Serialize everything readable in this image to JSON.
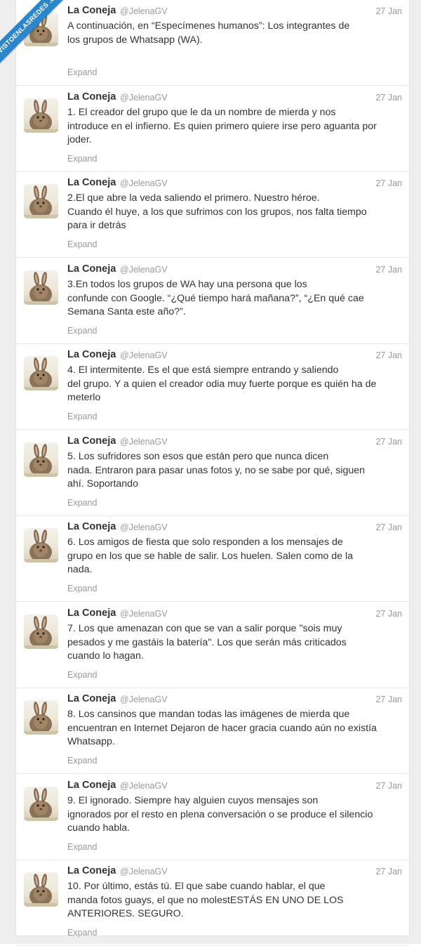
{
  "watermark": {
    "text": "VISTOENLASREDES .com"
  },
  "tweets": [
    {
      "name": "La Coneja",
      "handle": "@JelenaGV",
      "time": "27 Jan",
      "text": "A continuación, en “Especímenes humanos”: Los integrantes de\nlos grupos de Whatsapp (WA).",
      "expand": "Expand"
    },
    {
      "name": "La Coneja",
      "handle": "@JelenaGV",
      "time": "27 Jan",
      "text": "1. El creador del grupo que le da un nombre de mierda y nos\nintroduce en el infierno. Es quien primero quiere irse pero aguanta por\njoder.",
      "expand": "Expand"
    },
    {
      "name": "La Coneja",
      "handle": "@JelenaGV",
      "time": "27 Jan",
      "text": "2.El que abre la veda saliendo el primero. Nuestro héroe.\nCuando él huye, a los que sufrimos con los grupos, nos falta tiempo\npara ir detrás",
      "expand": "Expand"
    },
    {
      "name": "La Coneja",
      "handle": "@JelenaGV",
      "time": "27 Jan",
      "text": "3.En todos los grupos de WA hay una persona que los\nconfunde con Google. “¿Qué tiempo hará mañana?”, “¿En qué cae\nSemana Santa este año?”.",
      "expand": "Expand"
    },
    {
      "name": "La Coneja",
      "handle": "@JelenaGV",
      "time": "27 Jan",
      "text": "4. El intermitente. Es el que está siempre entrando y saliendo\ndel grupo. Y a quien el creador odia muy fuerte porque es quién ha de\nmeterlo",
      "expand": "Expand"
    },
    {
      "name": "La Coneja",
      "handle": "@JelenaGV",
      "time": "27 Jan",
      "text": "5. Los sufridores son esos que están pero que nunca dicen\nnada. Entraron para pasar unas fotos y, no se sabe por qué, siguen\nahí. Soportando",
      "expand": "Expand"
    },
    {
      "name": "La Coneja",
      "handle": "@JelenaGV",
      "time": "27 Jan",
      "text": "6. Los amigos de fiesta que solo responden a los mensajes de\ngrupo en los que se hable de salir. Los huelen. Salen como de la\nnada.",
      "expand": "Expand"
    },
    {
      "name": "La Coneja",
      "handle": "@JelenaGV",
      "time": "27 Jan",
      "text": "7. Los que amenazan con que se van a salir porque \"sois muy\npesados y me gastáis la batería\". Los que serán más criticados\ncuando lo hagan.",
      "expand": "Expand"
    },
    {
      "name": "La Coneja",
      "handle": "@JelenaGV",
      "time": "27 Jan",
      "text": "8. Los cansinos que mandan todas las imágenes de mierda que\nencuentran en Internet Dejaron de hacer gracia cuando aún no existía\nWhatsapp.",
      "expand": "Expand"
    },
    {
      "name": "La Coneja",
      "handle": "@JelenaGV",
      "time": "27 Jan",
      "text": "9. El ignorado. Siempre hay alguien cuyos mensajes son\nignorados por el resto en plena conversación o se produce el silencio\ncuando habla.",
      "expand": "Expand"
    },
    {
      "name": "La Coneja",
      "handle": "@JelenaGV",
      "time": "27 Jan",
      "text": "10. Por último, estás tú. El que sabe cuando hablar, el que\nmanda fotos guays, el que no molestESTÁS EN UNO DE LOS\nANTERIORES. SEGURO.",
      "expand": "Expand"
    }
  ]
}
